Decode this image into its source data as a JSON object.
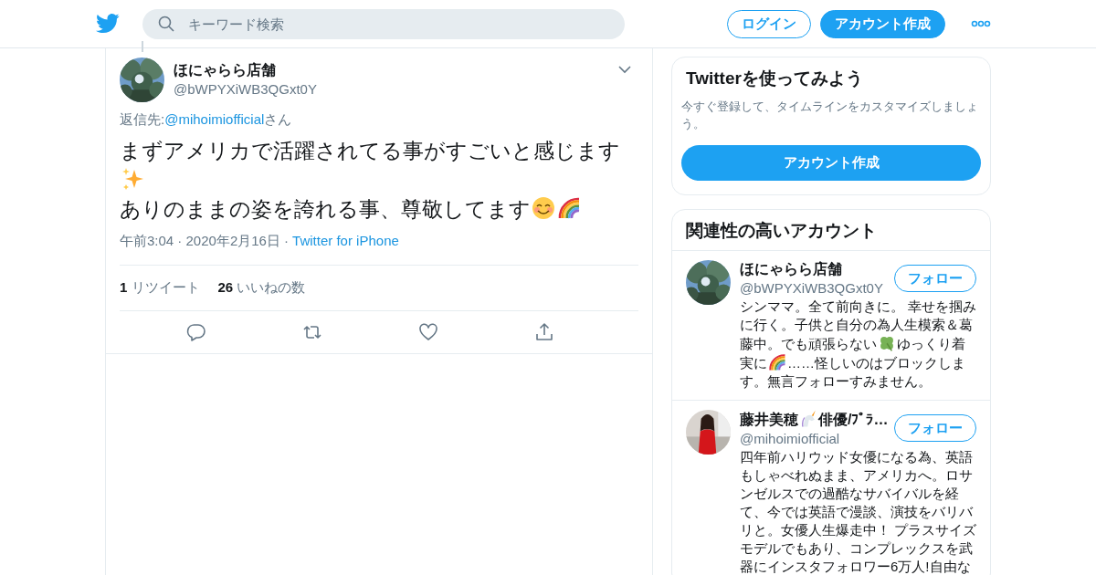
{
  "header": {
    "search": {
      "placeholder": "キーワード検索"
    },
    "buttons": [
      {
        "label": "ログイン",
        "kind": "outline"
      },
      {
        "label": "アカウント作成",
        "kind": "filled"
      }
    ]
  },
  "tweet": {
    "author": {
      "name": "ほにゃらら店舗",
      "handle": "@bWPYXiWB3QGxt0Y"
    },
    "reply_to": {
      "prefix": "返信先: ",
      "handle": "@mihoimiofficial",
      "suffix": "さん"
    },
    "body": [
      [
        {
          "kind": "text",
          "text": "まずアメリカで活躍されてる事がすごいと感じます"
        }
      ],
      [
        {
          "kind": "sparkles"
        }
      ],
      [
        {
          "kind": "text",
          "text": "ありのままの姿を誇れる事、尊敬してます"
        },
        {
          "kind": "smile"
        },
        {
          "kind": "rainbow"
        }
      ]
    ],
    "time": "午前3:04 · 2020年2月16日 ·",
    "source": "Twitter for iPhone",
    "stats": [
      {
        "count": "1",
        "label": "リツイート"
      },
      {
        "count": "26",
        "label": "いいねの数"
      }
    ]
  },
  "signup_card": {
    "title": "Twitterを使ってみよう",
    "text": "今すぐ登録して、タイムラインをカスタマイズしましょう。",
    "button": "アカウント作成"
  },
  "related": {
    "title": "関連性の高いアカウント",
    "accounts": [
      {
        "name": [
          {
            "kind": "text",
            "text": "ほにゃらら店舗"
          }
        ],
        "handle": "@bWPYXiWB3QGxt0Y",
        "button": "フォロー",
        "bio": [
          [
            {
              "kind": "text",
              "text": "シンママ。全て前向きに。 幸せを掴み"
            }
          ],
          [
            {
              "kind": "text",
              "text": "に行く。子供と自分の為人生模索＆葛"
            }
          ],
          [
            {
              "kind": "text",
              "text": "藤中。でも頑張らない"
            },
            {
              "kind": "clover"
            },
            {
              "kind": "text",
              "text": "ゆっくり着"
            }
          ],
          [
            {
              "kind": "text",
              "text": "実に"
            },
            {
              "kind": "rainbow"
            },
            {
              "kind": "text",
              "text": "……怪しいのはブロックしま"
            }
          ],
          [
            {
              "kind": "text",
              "text": "す。無言フォローすみません。"
            }
          ]
        ]
      },
      {
        "name": [
          {
            "kind": "text",
            "text": "藤井美穂"
          },
          {
            "kind": "unicorn"
          },
          {
            "kind": "text",
            "text": "俳優/ﾌﾟﾗ…"
          }
        ],
        "handle": "@mihoimiofficial",
        "button": "フォロー",
        "bio": [
          [
            {
              "kind": "text",
              "text": "四年前ハリウッド女優になる為、英語"
            }
          ],
          [
            {
              "kind": "text",
              "text": "もしゃべれぬまま、アメリカへ。ロサ"
            }
          ],
          [
            {
              "kind": "text",
              "text": "ンゼルスでの過酷なサバイバルを経"
            }
          ],
          [
            {
              "kind": "text",
              "text": "て、今では英語で漫談、演技をバリバ"
            }
          ],
          [
            {
              "kind": "text",
              "text": "リと。女優人生爆走中！ プラスサイズ"
            }
          ],
          [
            {
              "kind": "text",
              "text": "モデルでもあり、コンプレックスを武"
            }
          ],
          [
            {
              "kind": "text",
              "text": "器にインスタフォロワー6万人!自由な"
            }
          ]
        ]
      }
    ]
  }
}
